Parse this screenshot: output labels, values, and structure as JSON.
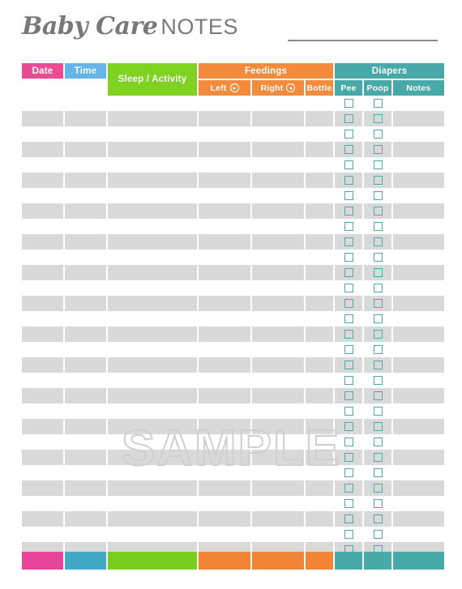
{
  "header": {
    "title_script": "Baby Care",
    "title_plain": "NOTES",
    "rule": "write-on-line"
  },
  "table": {
    "group_headers": [
      {
        "key": "feedings",
        "label": "Feedings",
        "color": "#f28b3c"
      },
      {
        "key": "diapers",
        "label": "Diapers",
        "color": "#47aaa8"
      }
    ],
    "columns": [
      {
        "key": "date",
        "label": "Date",
        "color": "#ea4c94",
        "footer_color": "#e8459a",
        "type": "text"
      },
      {
        "key": "time",
        "label": "Time",
        "color": "#66b5e8",
        "footer_color": "#41a9c6",
        "type": "text"
      },
      {
        "key": "sleep",
        "label": "Sleep / Activity",
        "color": "#7ed321",
        "footer_color": "#79cf20",
        "type": "text"
      },
      {
        "key": "left",
        "label": "Left",
        "color": "#f28b3c",
        "footer_color": "#f28435",
        "type": "text",
        "icon": "clock-toggle-icon"
      },
      {
        "key": "right",
        "label": "Right",
        "color": "#f28b3c",
        "footer_color": "#f28435",
        "type": "text",
        "icon": "clock-toggle-icon"
      },
      {
        "key": "bottle",
        "label": "Bottle",
        "color": "#f28b3c",
        "footer_color": "#f28435",
        "type": "text"
      },
      {
        "key": "pee",
        "label": "Pee",
        "color": "#47aaa8",
        "footer_color": "#47aaa8",
        "type": "checkbox"
      },
      {
        "key": "poop",
        "label": "Poop",
        "color": "#47aaa8",
        "footer_color": "#47aaa8",
        "type": "checkbox"
      },
      {
        "key": "notes",
        "label": "Notes",
        "color": "#47aaa8",
        "footer_color": "#47aaa8",
        "type": "text"
      }
    ],
    "row_count": 30,
    "rows_shaded_alternating": true,
    "row_fill_color": "#d9d9d9",
    "checkbox_border_color": "#4ea8a6",
    "entries": []
  },
  "watermark": {
    "text": "SAMPLE",
    "color": "#cfcfcf"
  }
}
